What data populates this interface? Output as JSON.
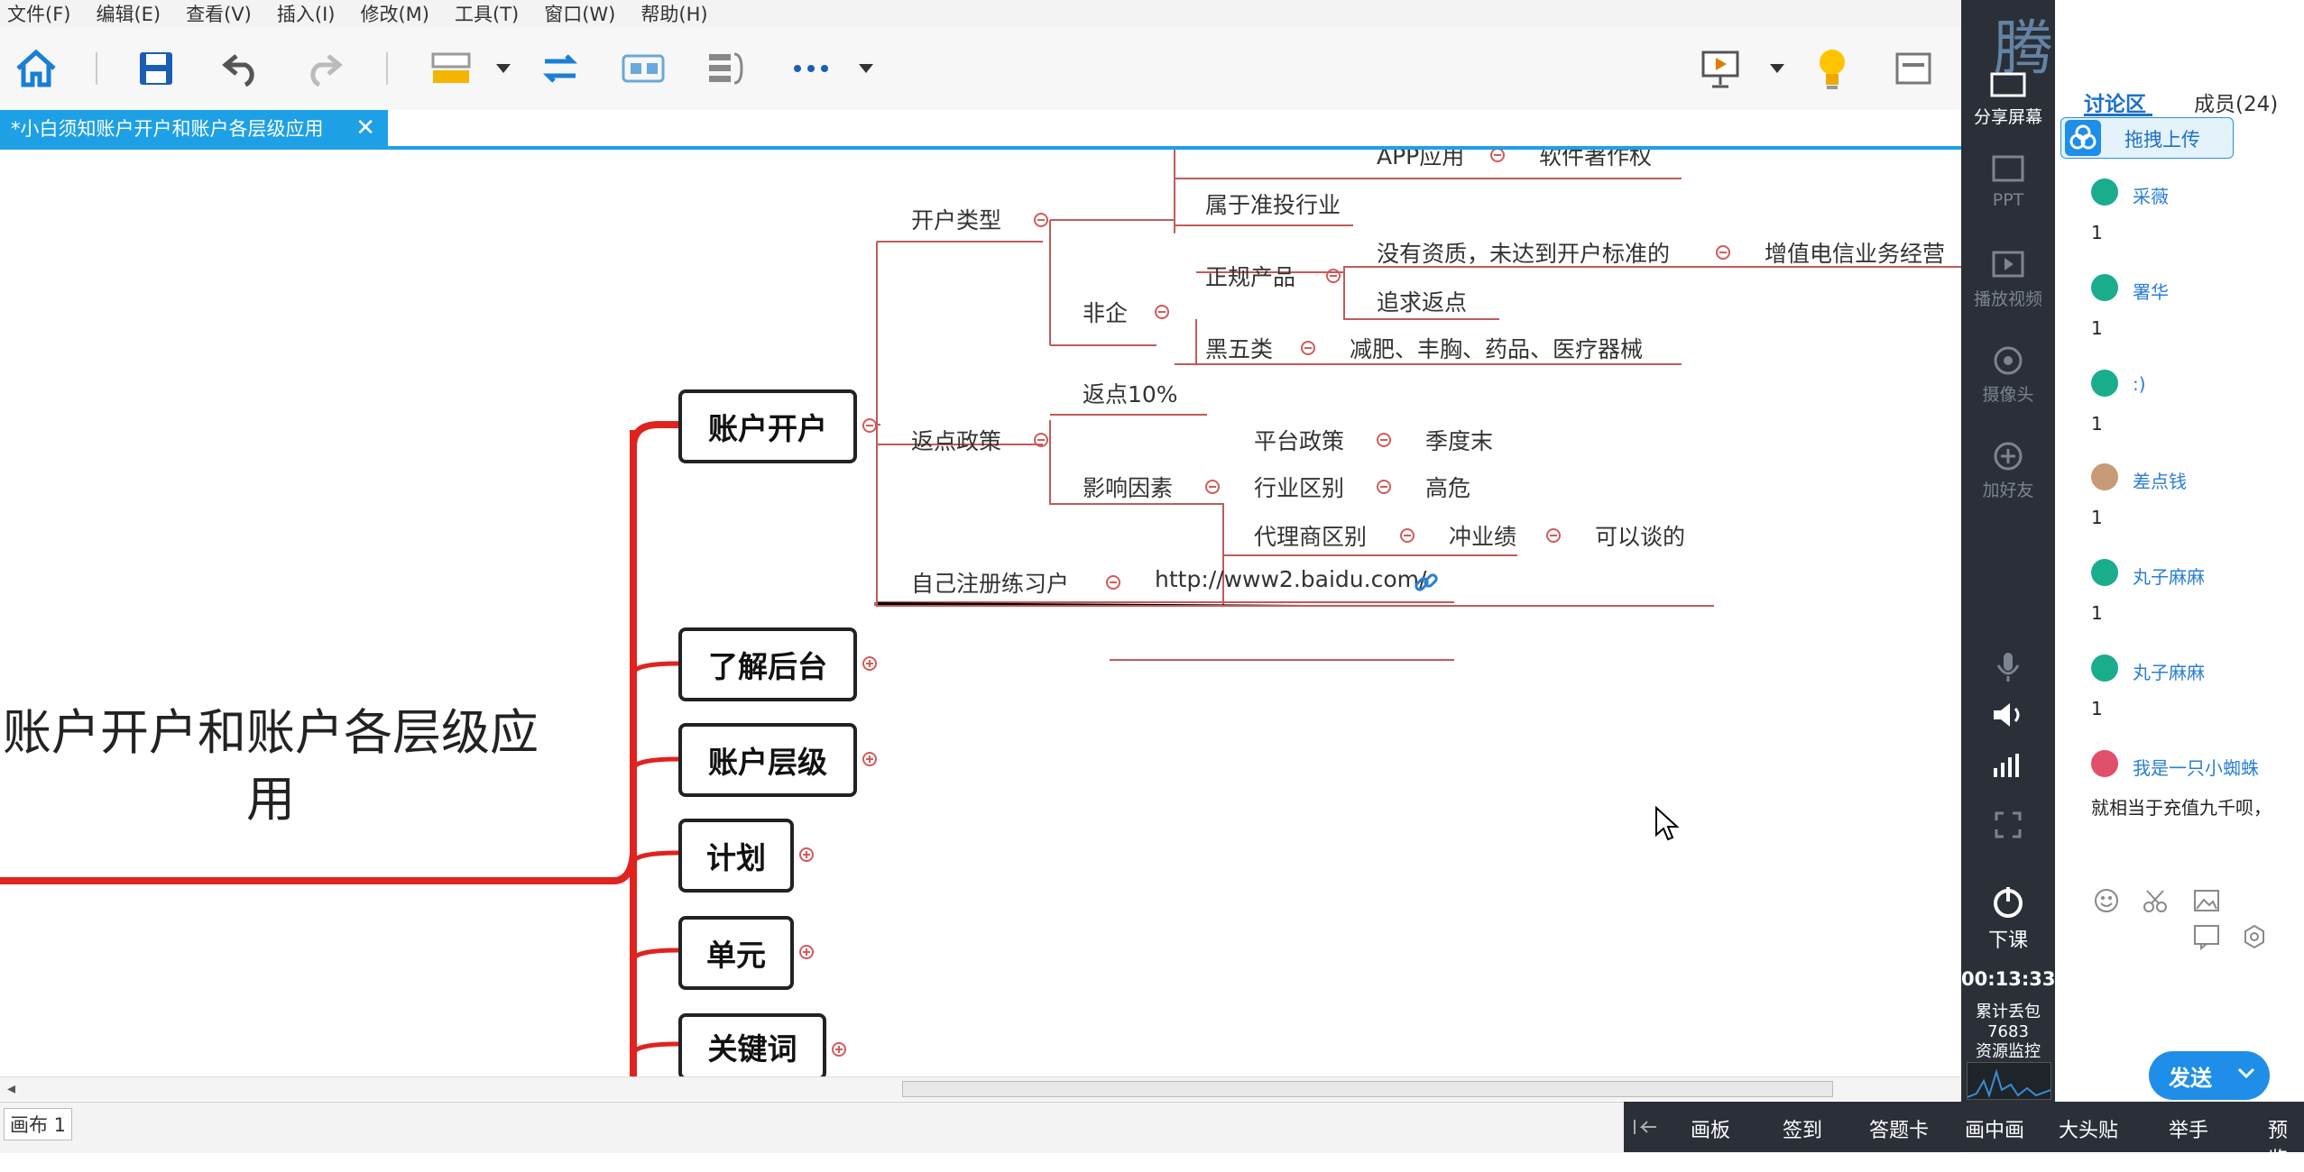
{
  "menu": [
    "文件(F)",
    "编辑(E)",
    "查看(V)",
    "插入(I)",
    "修改(M)",
    "工具(T)",
    "窗口(W)",
    "帮助(H)"
  ],
  "tab": {
    "title": "*小白须知账户开户和账户各层级应用",
    "close": "✕"
  },
  "root": {
    "line1": "账户开户和账户各层级应",
    "line2": "用"
  },
  "branches": {
    "b1": "账户开户",
    "b2": "了解后台",
    "b3": "账户层级",
    "b4": "计划",
    "b5": "单元",
    "b6": "关键词"
  },
  "nodes": {
    "kaihu_type": "开户类型",
    "app": "APP应用",
    "ruanzhu": "软件著作权",
    "zhuntou": "属于准投行业",
    "feiqi": "非企",
    "zhenggui": "正规产品",
    "meiyou": "没有资质，未达到开户标准的",
    "zengzhi": "增值电信业务经营",
    "zhuiqiu": "追求返点",
    "heiwu": "黑五类",
    "jianfei": "减肥、丰胸、药品、医疗器械",
    "fandian_zc": "返点政策",
    "fandian10": "返点10%",
    "yingxiang": "影响因素",
    "pingtai": "平台政策",
    "jidu": "季度末",
    "hangye": "行业区别",
    "gaowei": "高危",
    "daili": "代理商区别",
    "chongye": "冲业绩",
    "keyi": "可以谈的",
    "zizhu": "自己注册练习户",
    "url": "http://www2.baidu.com/"
  },
  "canvas_tab": "画布 1",
  "logo": "腾讯课堂",
  "sidebar": {
    "share": "分享屏幕",
    "ppt": "PPT",
    "video": "播放视频",
    "camera": "摄像头",
    "addfriend": "加好友",
    "endclass": "下课",
    "timer": "00:13:33",
    "stats1": "累计丢包",
    "stats2": "7683",
    "stats3": "资源监控"
  },
  "chat": {
    "tab_discuss": "讨论区",
    "tab_members": "成员(24)",
    "upload": "拖拽上传",
    "messages": [
      {
        "name": "采薇",
        "body": "1"
      },
      {
        "name": "署华",
        "body": "1"
      },
      {
        "name": ":)",
        "body": "1"
      },
      {
        "name": "差点钱",
        "body": "1"
      },
      {
        "name": "丸子麻麻",
        "body": "1"
      },
      {
        "name": "丸子麻麻",
        "body": "1"
      },
      {
        "name": "我是一只小蜘蛛",
        "body": "就相当于充值九千呗，"
      }
    ],
    "send": "发送"
  },
  "bottom": [
    "画板",
    "签到",
    "答题卡",
    "画中画",
    "大头贴",
    "举手",
    "预览"
  ],
  "colors": {
    "accent": "#1ea0e6",
    "line": "#d35a5a",
    "trunk": "#e0231f"
  }
}
